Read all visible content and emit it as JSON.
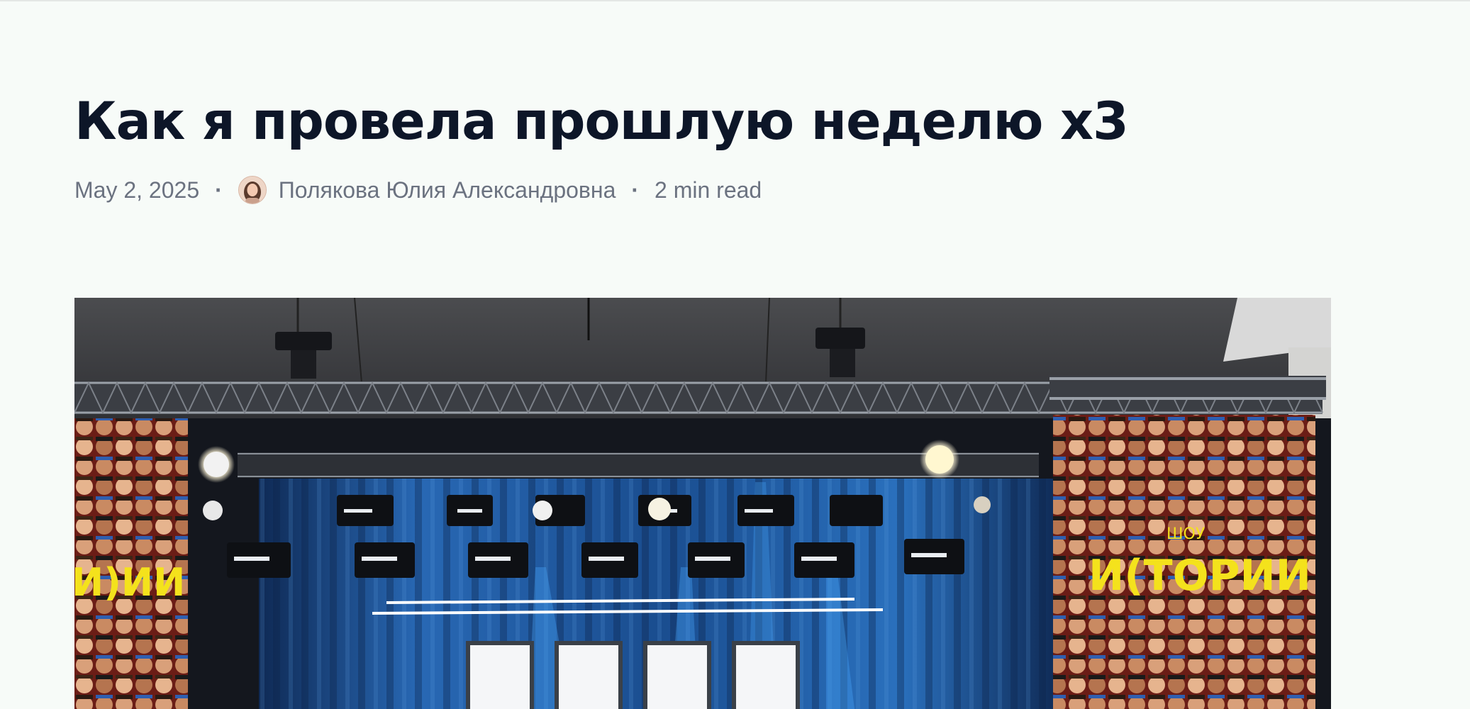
{
  "article": {
    "title": "Как я провела прошлую неделю x3",
    "date": "May 2, 2025",
    "separator": "·",
    "author": "Полякова Юлия Александровна",
    "read_time": "2 min read"
  },
  "hero_image": {
    "poster_text_left": "И)ИИ",
    "poster_text_right": "И(ТОРИИ",
    "poster_small_text": "ШОУ"
  },
  "colors": {
    "background": "#f7fbf8",
    "title": "#0d1628",
    "meta": "#6b7280",
    "curtain": "#1f5fa8",
    "poster_yellow": "#f4e21c"
  }
}
